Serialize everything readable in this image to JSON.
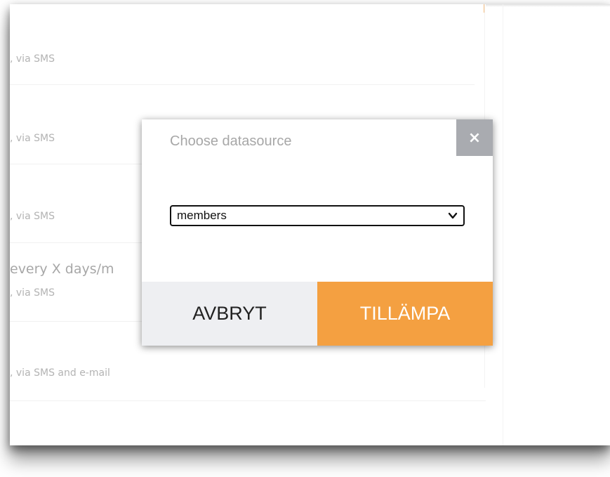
{
  "background_rows": [
    {
      "title": "",
      "detail": ", via SMS"
    },
    {
      "title": "",
      "detail": ", via SMS"
    },
    {
      "title": "",
      "detail": ", via SMS"
    },
    {
      "title": "every X days/m",
      "detail": ", via SMS"
    },
    {
      "title": "",
      "detail": ", via SMS and e-mail"
    }
  ],
  "modal": {
    "title": "Choose datasource",
    "close_label": "×",
    "datasource_select": {
      "selected_value": "members"
    },
    "cancel_label": "AVBRYT",
    "apply_label": "TILLÄMPA"
  },
  "colors": {
    "accent": "#f4a041",
    "close_bg": "#a9abb0",
    "cancel_bg": "#eeeff2"
  }
}
